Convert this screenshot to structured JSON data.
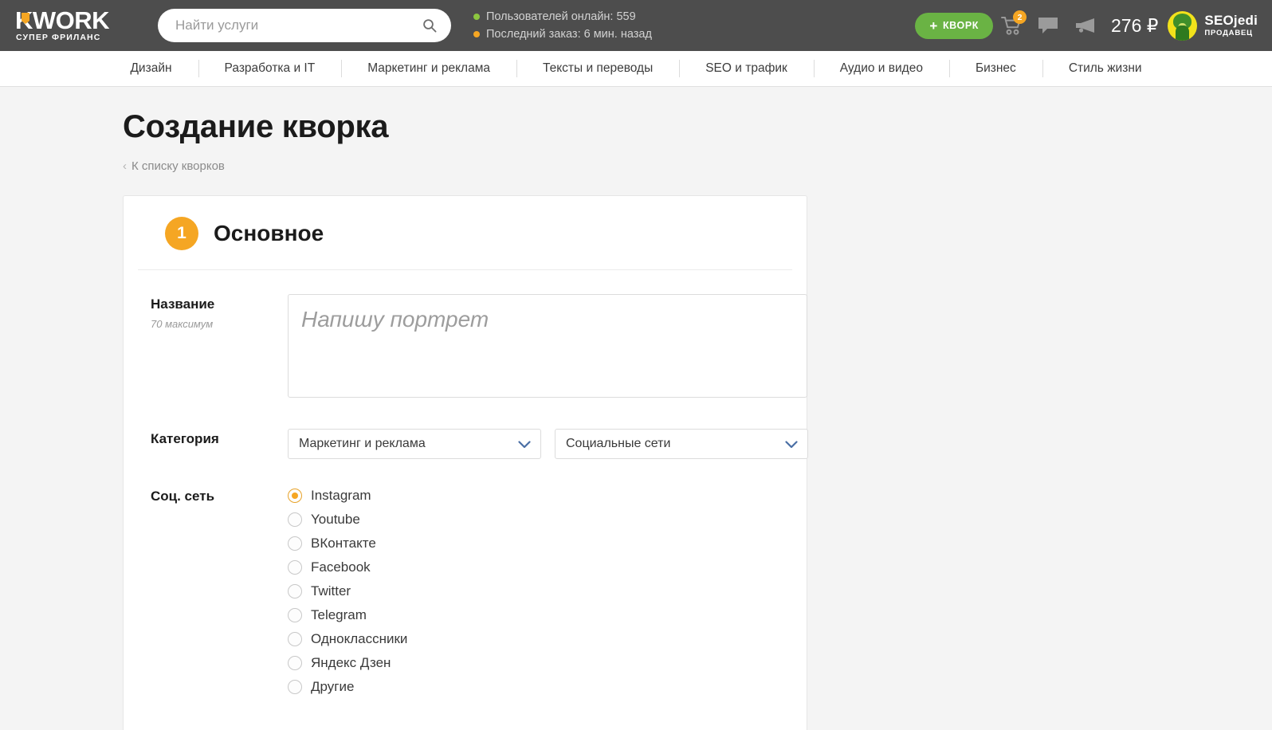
{
  "header": {
    "logo": {
      "word": "KWORK",
      "sub": "СУПЕР ФРИЛАНС"
    },
    "search": {
      "placeholder": "Найти услуги",
      "value": "",
      "icon": "search-icon"
    },
    "status": [
      {
        "dot": "green",
        "text": "Пользователей онлайн: 559"
      },
      {
        "dot": "orange",
        "text": "Последний заказ: 6 мин. назад"
      }
    ],
    "create_button": {
      "plus": "+",
      "label": "КВОРК"
    },
    "icons": [
      {
        "name": "cart-icon",
        "badge": "2"
      },
      {
        "name": "chat-icon",
        "badge": ""
      },
      {
        "name": "megaphone-icon",
        "badge": ""
      }
    ],
    "balance": "276 ₽",
    "user": {
      "name": "SEOjedi",
      "role": "ПРОДАВЕЦ",
      "avatar": "user-avatar"
    }
  },
  "nav": {
    "items": [
      {
        "label": "Дизайн"
      },
      {
        "label": "Разработка и IT"
      },
      {
        "label": "Маркетинг и реклама"
      },
      {
        "label": "Тексты и переводы"
      },
      {
        "label": "SEO и трафик"
      },
      {
        "label": "Аудио и видео"
      },
      {
        "label": "Бизнес"
      },
      {
        "label": "Стиль жизни"
      }
    ]
  },
  "page": {
    "title": "Создание кворка",
    "back_link": "К списку кворков",
    "back_chevron": "‹"
  },
  "card": {
    "step_number": "1",
    "step_title": "Основное",
    "fields": {
      "title": {
        "label": "Название",
        "hint": "70 максимум",
        "placeholder": "Напишу портрет",
        "value": ""
      },
      "category": {
        "label": "Категория",
        "primary_value": "Маркетинг и реклама",
        "secondary_value": "Социальные сети"
      },
      "social": {
        "label": "Соц. сеть",
        "selected": "Instagram",
        "options": [
          {
            "label": "Instagram",
            "checked": true
          },
          {
            "label": "Youtube",
            "checked": false
          },
          {
            "label": "ВКонтакте",
            "checked": false
          },
          {
            "label": "Facebook",
            "checked": false
          },
          {
            "label": "Twitter",
            "checked": false
          },
          {
            "label": "Telegram",
            "checked": false
          },
          {
            "label": "Одноклассники",
            "checked": false
          },
          {
            "label": "Яндекс Дзен",
            "checked": false
          },
          {
            "label": "Другие",
            "checked": false
          }
        ]
      }
    }
  },
  "colors": {
    "header_bg": "#4d4d4d",
    "accent_orange": "#f5a623",
    "accent_green": "#6ab344",
    "page_bg": "#f4f4f4",
    "chevron_blue": "#4a6fa5"
  }
}
